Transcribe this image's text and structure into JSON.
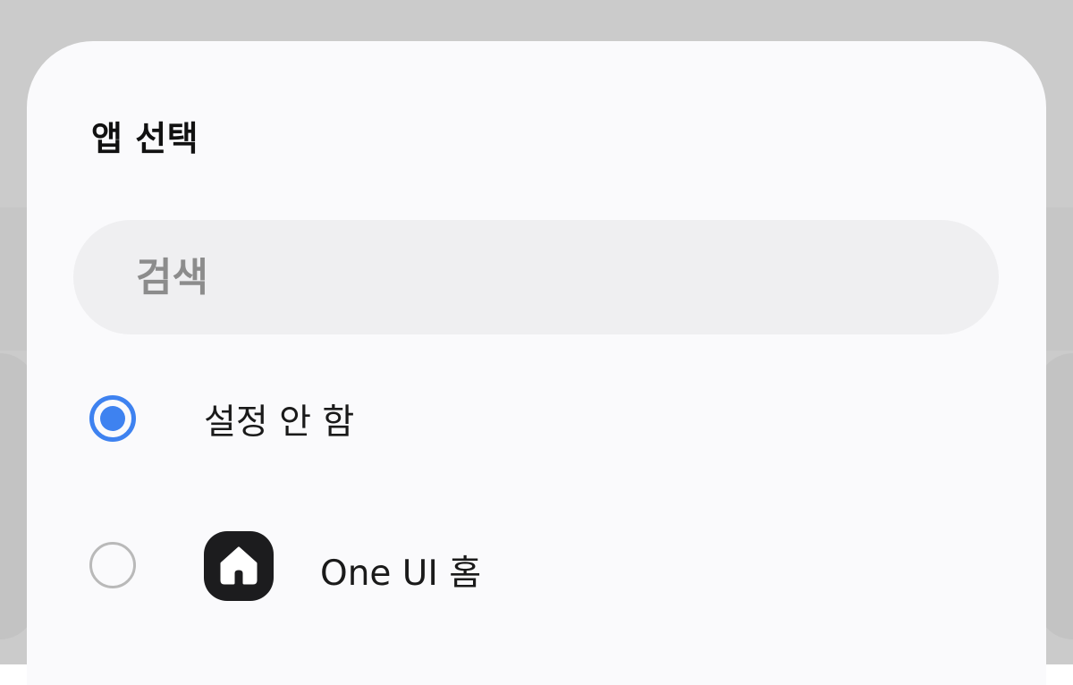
{
  "dialog": {
    "title": "앱 선택"
  },
  "search": {
    "placeholder": "검색"
  },
  "options": [
    {
      "label": "설정 안 함",
      "selected": true
    },
    {
      "label": "One UI 홈",
      "selected": false,
      "icon": "home-icon"
    }
  ],
  "colors": {
    "accent": "#3e82f0",
    "sheet_background": "#fafafc",
    "scrim": "#cbcbcb",
    "search_background": "#efeff1"
  }
}
